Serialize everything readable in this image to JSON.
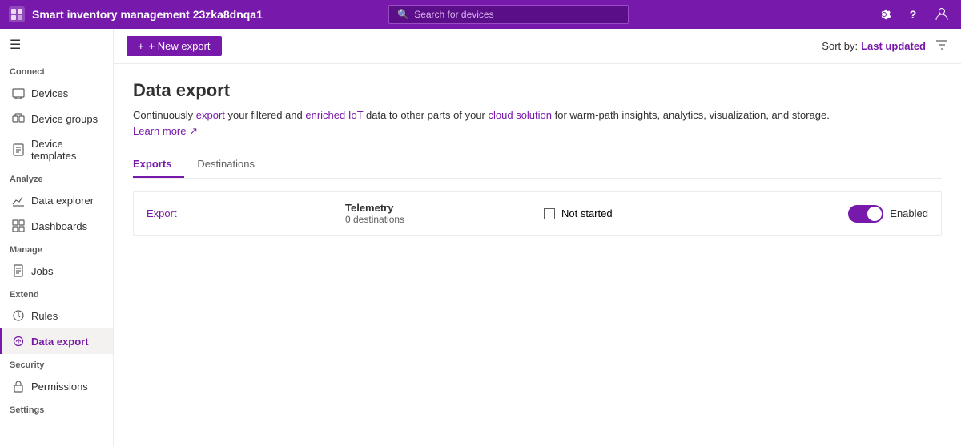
{
  "app": {
    "name": "Smart inventory management 23zka8dnqa1"
  },
  "topbar": {
    "search_placeholder": "Search for devices",
    "settings_icon": "⚙",
    "help_icon": "?",
    "user_icon": "👤"
  },
  "sidebar": {
    "hamburger": "☰",
    "sections": [
      {
        "label": "Connect",
        "items": [
          {
            "id": "devices",
            "label": "Devices",
            "icon": "📱",
            "active": false
          },
          {
            "id": "device-groups",
            "label": "Device groups",
            "icon": "📊",
            "active": false
          },
          {
            "id": "device-templates",
            "label": "Device templates",
            "icon": "📋",
            "active": false
          }
        ]
      },
      {
        "label": "Analyze",
        "items": [
          {
            "id": "data-explorer",
            "label": "Data explorer",
            "icon": "📈",
            "active": false
          },
          {
            "id": "dashboards",
            "label": "Dashboards",
            "icon": "⊞",
            "active": false
          }
        ]
      },
      {
        "label": "Manage",
        "items": [
          {
            "id": "jobs",
            "label": "Jobs",
            "icon": "💼",
            "active": false
          }
        ]
      },
      {
        "label": "Extend",
        "items": [
          {
            "id": "rules",
            "label": "Rules",
            "icon": "⚙",
            "active": false
          },
          {
            "id": "data-export",
            "label": "Data export",
            "icon": "↗",
            "active": true
          }
        ]
      },
      {
        "label": "Security",
        "items": [
          {
            "id": "permissions",
            "label": "Permissions",
            "icon": "🔑",
            "active": false
          }
        ]
      },
      {
        "label": "Settings",
        "items": []
      }
    ]
  },
  "toolbar": {
    "new_export_label": "+ New export",
    "sort_by_label": "Sort by:",
    "sort_value": "Last updated",
    "filter_icon": "▽"
  },
  "page": {
    "title": "Data export",
    "description_parts": [
      "Continuously ",
      "export",
      " your filtered and ",
      "enriched IoT",
      " data to other parts of your ",
      "cloud solution",
      " for warm-path insights, analytics, visualization, and storage. ",
      "Learn more"
    ],
    "desc_text": "Continuously export your filtered and enriched IoT data to other parts of your cloud solution for warm-path insights, analytics, visualization, and storage.",
    "learn_more": "Learn more"
  },
  "tabs": [
    {
      "id": "exports",
      "label": "Exports",
      "active": true
    },
    {
      "id": "destinations",
      "label": "Destinations",
      "active": false
    }
  ],
  "exports": [
    {
      "name": "Export",
      "type": "Telemetry",
      "destinations": "0 destinations",
      "status": "Not started",
      "enabled": true,
      "enabled_label": "Enabled"
    }
  ]
}
